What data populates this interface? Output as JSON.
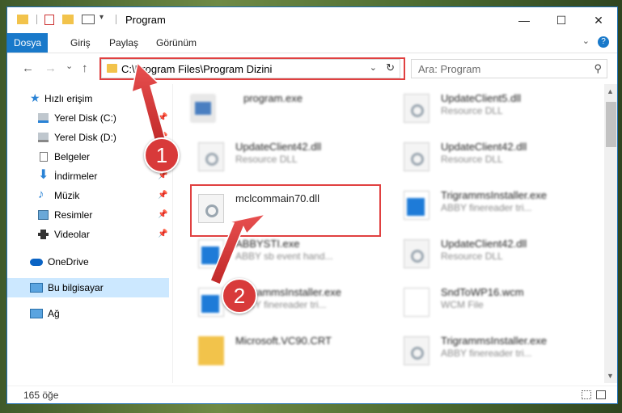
{
  "window": {
    "title": "Program",
    "controls": {
      "minimize": "—",
      "maximize": "☐",
      "close": "✕"
    }
  },
  "ribbon": {
    "tabs": [
      {
        "label": "Dosya",
        "active": true
      },
      {
        "label": "Giriş"
      },
      {
        "label": "Paylaş"
      },
      {
        "label": "Görünüm"
      }
    ],
    "help": "?"
  },
  "nav": {
    "back": "←",
    "forward": "→",
    "recent": "⌄",
    "up": "↑",
    "address": "C:\\Program Files\\Program Dizini",
    "search_placeholder": "Ara: Program"
  },
  "sidebar": {
    "items": [
      {
        "label": "Hızlı erişim",
        "icon": "star-icon"
      },
      {
        "label": "Yerel Disk (C:)",
        "icon": "drive-icon",
        "pinned": true
      },
      {
        "label": "Yerel Disk (D:)",
        "icon": "drive-icon",
        "pinned": true
      },
      {
        "label": "Belgeler",
        "icon": "documents-icon",
        "pinned": true
      },
      {
        "label": "İndirmeler",
        "icon": "download-icon",
        "pinned": true
      },
      {
        "label": "Müzik",
        "icon": "music-icon",
        "pinned": true
      },
      {
        "label": "Resimler",
        "icon": "pictures-icon",
        "pinned": true
      },
      {
        "label": "Videolar",
        "icon": "videos-icon",
        "pinned": true
      },
      {
        "label": "OneDrive",
        "icon": "cloud-icon"
      },
      {
        "label": "Bu bilgisayar",
        "icon": "computer-icon",
        "selected": true
      },
      {
        "label": "Ağ",
        "icon": "network-icon"
      }
    ]
  },
  "files": [
    {
      "name": "program.exe",
      "type": "",
      "icon": "program-exe-icon"
    },
    {
      "name": "UpdateClient5.dll",
      "type": "Resource DLL",
      "icon": "dll-icon"
    },
    {
      "name": "UpdateClient42.dll",
      "type": "Resource DLL",
      "icon": "dll-icon"
    },
    {
      "name": "UpdateClient42.dll",
      "type": "Resource DLL",
      "icon": "dll-icon"
    },
    {
      "name": "mclcommain70.dll",
      "type": "",
      "icon": "dll-icon"
    },
    {
      "name": "TrigrammsInstaller.exe",
      "type": "ABBY finereader tri...",
      "icon": "exe-icon"
    },
    {
      "name": "ABBYSTI.exe",
      "type": "ABBY sb event hand...",
      "icon": "exe-icon"
    },
    {
      "name": "UpdateClient42.dll",
      "type": "Resource DLL",
      "icon": "dll-icon"
    },
    {
      "name": "TrigrammsInstaller.exe",
      "type": "ABBY finereader tri...",
      "icon": "exe-icon"
    },
    {
      "name": "SndToWP16.wcm",
      "type": "WCM File",
      "icon": "file-icon"
    },
    {
      "name": "Microsoft.VC90.CRT",
      "type": "",
      "icon": "folder-icon"
    },
    {
      "name": "TrigrammsInstaller.exe",
      "type": "ABBY finereader tri...",
      "icon": "exe-icon"
    }
  ],
  "status": {
    "count": "165 öğe"
  },
  "annotations": {
    "step1": "1",
    "step2": "2"
  },
  "colors": {
    "accent": "#1979ca",
    "highlight": "#e04040",
    "selected": "#cce8ff"
  }
}
